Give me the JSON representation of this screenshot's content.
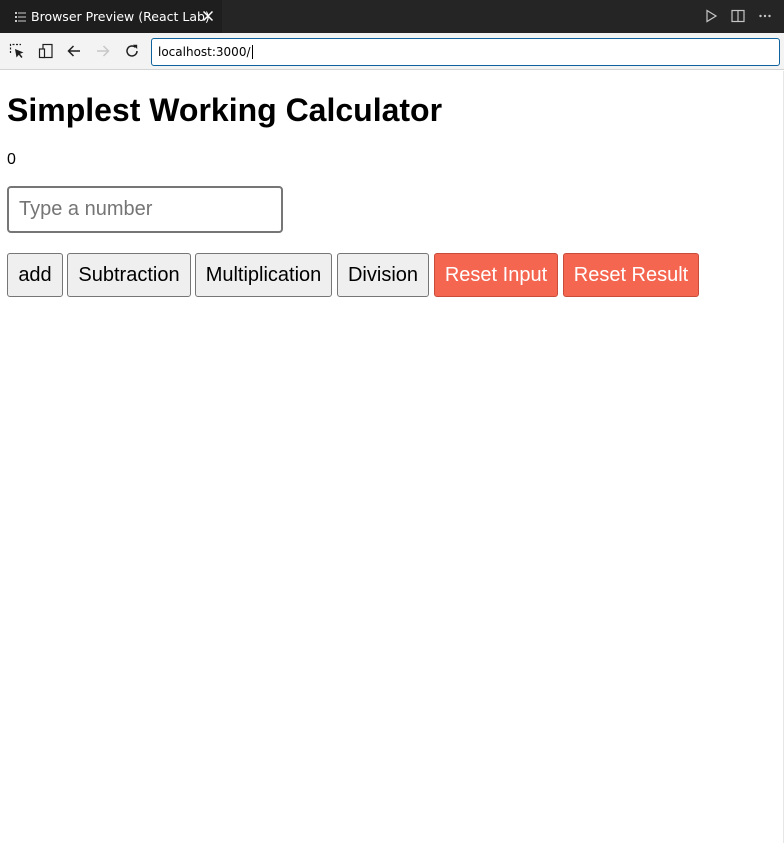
{
  "tab": {
    "title": "Browser Preview (React Lab)",
    "icon": "preview-icon",
    "close_icon": "close-icon"
  },
  "tab_actions": [
    "run-icon",
    "split-editor-icon",
    "more-actions-icon"
  ],
  "toolbar": {
    "buttons": [
      "inspect-icon",
      "device-icon",
      "back-icon",
      "forward-icon",
      "reload-icon"
    ],
    "url": "localhost:3000/"
  },
  "page": {
    "title": "Simplest Working Calculator",
    "result": "0",
    "input_placeholder": "Type a number",
    "input_value": "",
    "buttons": {
      "add": "add",
      "subtract": "Subtraction",
      "multiply": "Multiplication",
      "divide": "Division",
      "reset_input": "Reset Input",
      "reset_result": "Reset Result"
    }
  },
  "colors": {
    "tab_bar": "#252526",
    "active_tab": "#1e1e1e",
    "url_focus_border": "#0e639c",
    "reset_button": "#f56651",
    "default_button": "#efefef"
  }
}
